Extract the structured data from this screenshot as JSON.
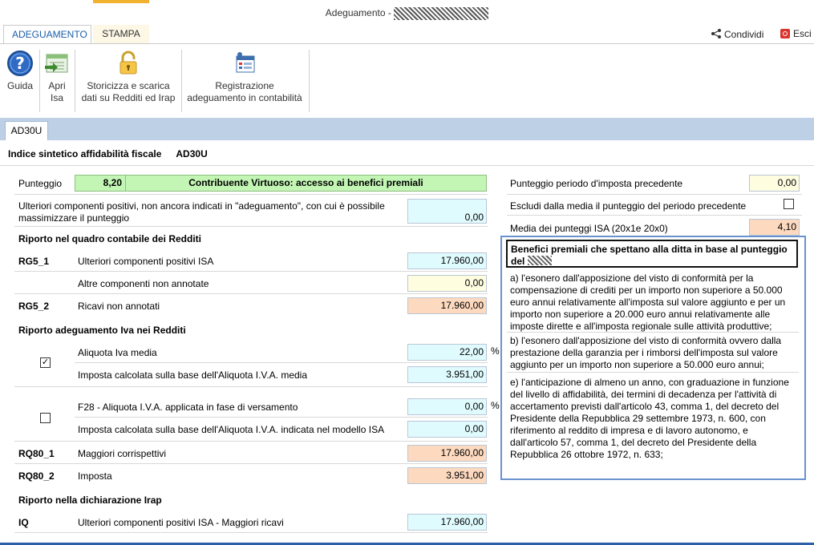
{
  "window": {
    "title": "Adeguamento -"
  },
  "ribbon_tabs": [
    {
      "label": "ADEGUAMENTO",
      "active": true
    },
    {
      "label": "STAMPA",
      "active": false
    }
  ],
  "top_actions": {
    "share_label": "Condividi",
    "exit_label": "Esci"
  },
  "ribbon_buttons": {
    "guida": "Guida",
    "apri_isa_1": "Apri",
    "apri_isa_2": "Isa",
    "storicizza_1": "Storicizza e scarica",
    "storicizza_2": "dati su Redditi ed Irap",
    "registrazione_1": "Registrazione",
    "registrazione_2": "adeguamento in contabilità"
  },
  "form_tab": "AD30U",
  "heading": {
    "title": "Indice sintetico affidabilità fiscale",
    "code": "AD30U"
  },
  "punteggio": {
    "label": "Punteggio",
    "value": "8,20",
    "status": "Contribuente Virtuoso: accesso ai benefici premiali"
  },
  "ulteriori": {
    "label_1": "Ulteriori componenti positivi, non ancora indicati in \"adeguamento\", con cui è possibile",
    "label_2": "massimizzare il punteggio",
    "value": "0,00"
  },
  "sections": {
    "redditi": "Riporto nel quadro contabile dei Redditi",
    "iva": "Riporto adeguamento Iva nei Redditi",
    "irap": "Riporto nella dichiarazione Irap"
  },
  "rows": {
    "rg5_1": {
      "code": "RG5_1",
      "label": "Ulteriori componenti positivi ISA",
      "value": "17.960,00"
    },
    "altre": {
      "label": "Altre componenti non annotate",
      "value": "0,00"
    },
    "rg5_2": {
      "code": "RG5_2",
      "label": "Ricavi non annotati",
      "value": "17.960,00"
    },
    "aliquota": {
      "label": "Aliquota Iva media",
      "value": "22,00",
      "unit": "%"
    },
    "imposta_media": {
      "label": "Imposta calcolata sulla base dell'Aliquota I.V.A. media",
      "value": "3.951,00"
    },
    "f28": {
      "label": "F28 - Aliquota I.V.A. applicata in fase di versamento",
      "value": "0,00",
      "unit": "%"
    },
    "imposta_isa": {
      "label": "Imposta calcolata sulla base dell'Aliquota I.V.A. indicata nel modello ISA",
      "value": "0,00"
    },
    "rq80_1": {
      "code": "RQ80_1",
      "label": "Maggiori corrispettivi",
      "value": "17.960,00"
    },
    "rq80_2": {
      "code": "RQ80_2",
      "label": "Imposta",
      "value": "3.951,00"
    },
    "iq": {
      "code": "IQ",
      "label": "Ulteriori componenti positivi ISA - Maggiori ricavi",
      "value": "17.960,00"
    }
  },
  "checkboxes": {
    "aliquota_media_checked": true,
    "f28_checked": false,
    "escludi_checked": false,
    "check_glyph": "✓"
  },
  "right_panel": {
    "precedente": {
      "label": "Punteggio periodo d'imposta precedente",
      "value": "0,00"
    },
    "escludi": {
      "label": "Escludi dalla media il punteggio del periodo precedente"
    },
    "media": {
      "label": "Media dei punteggi ISA (20x1e 20x0)",
      "value": "4,10"
    }
  },
  "benefits": {
    "title": "Benefici premiali che spettano alla ditta in base al punteggio del",
    "para_a": "a) l'esonero dall'apposizione del visto di conformità per la compensazione di crediti per un importo non superiore a 50.000 euro annui relativamente all'imposta sul valore aggiunto e per un importo non superiore a 20.000 euro annui relativamente alle imposte dirette e all'imposta regionale sulle attività produttive;",
    "para_b": "b) l'esonero dall'apposizione del visto di conformità ovvero dalla prestazione della garanzia per i rimborsi dell'imposta sul valore aggiunto per un importo non superiore a 50.000 euro annui;",
    "para_e": "e) l'anticipazione di almeno un anno, con graduazione in funzione del livello di affidabilità, dei termini di decadenza per l'attività di accertamento previsti dall'articolo 43, comma 1, del decreto del Presidente della Repubblica 29 settembre 1973, n. 600, con riferimento al reddito di impresa e di lavoro autonomo, e dall'articolo 57, comma 1, del decreto del Presidente della Repubblica 26 ottobre 1972, n. 633;"
  },
  "colors": {
    "accent_blue": "#1b5ea8",
    "tab_strip": "#bed0e6",
    "stampa_accent": "#f2b130"
  }
}
